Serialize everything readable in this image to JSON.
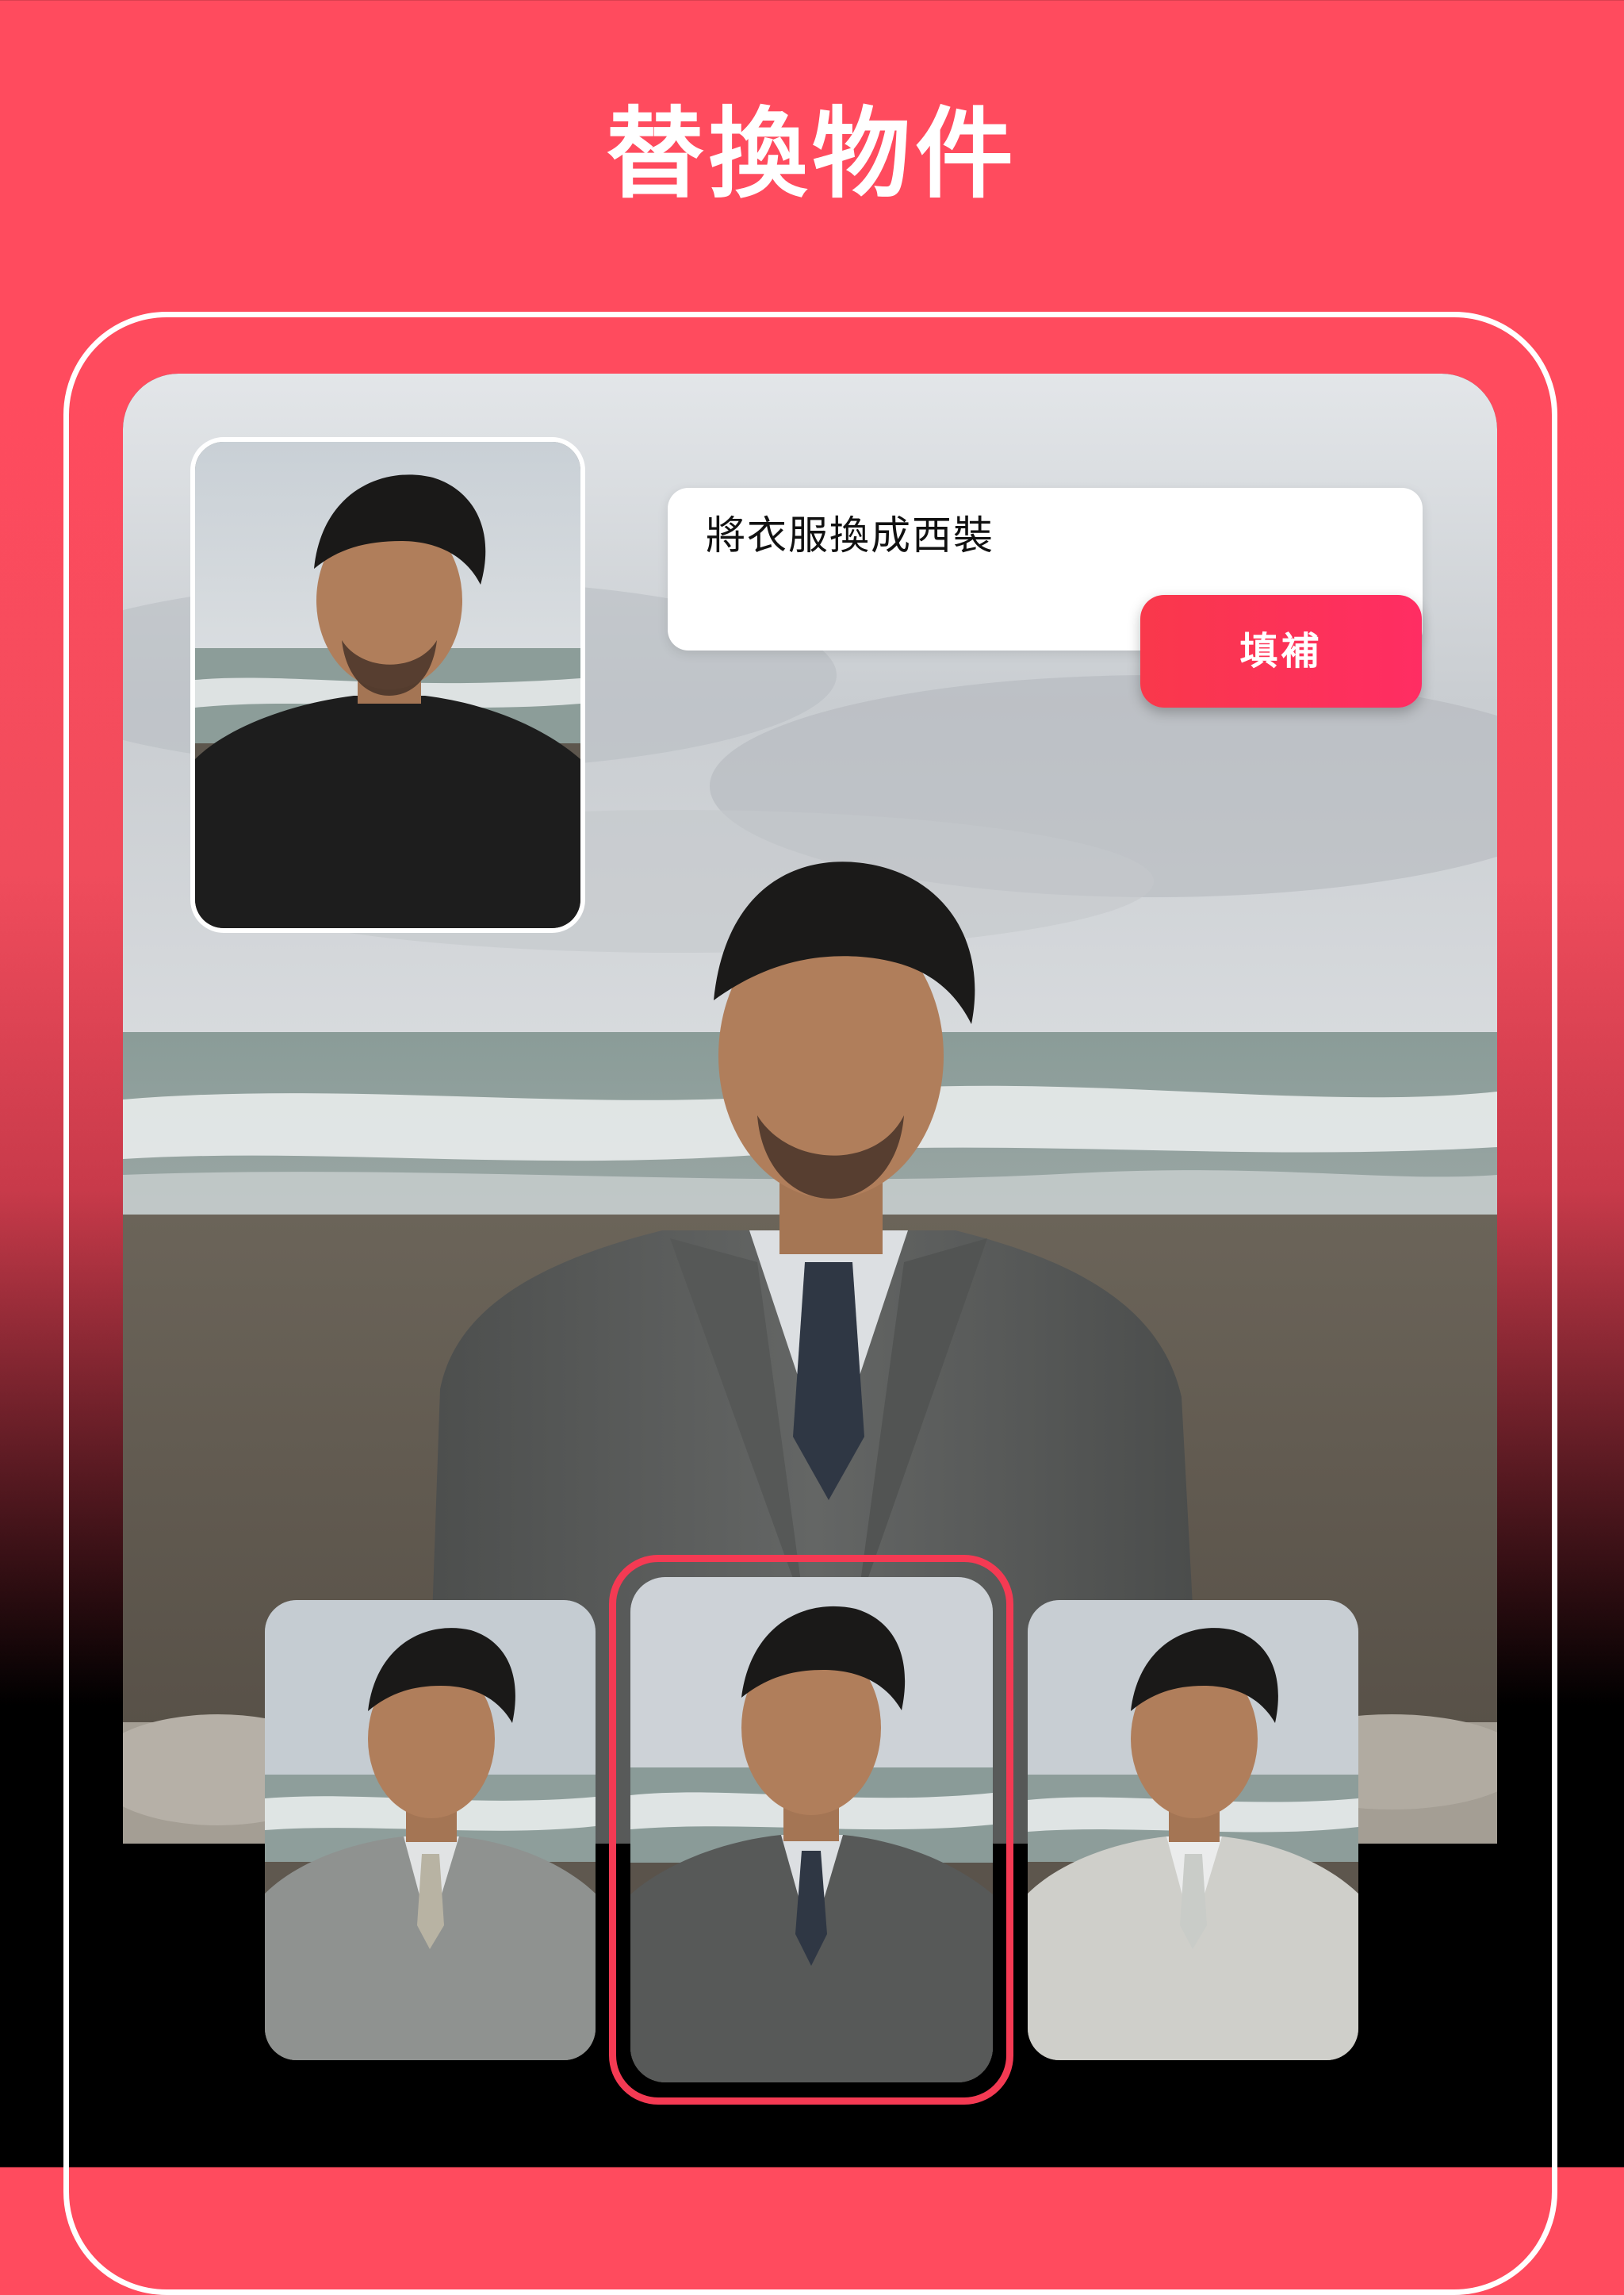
{
  "header": {
    "title": "替換物件"
  },
  "prompt": {
    "text": "將衣服換成西裝",
    "fill_button_label": "填補"
  },
  "results": {
    "count": 3,
    "selected_index": 1
  },
  "colors": {
    "brand_red": "#ff4b5e",
    "button_gradient_start": "#f9384b",
    "button_gradient_end": "#ff2d63",
    "selection_ring": "#f43a53"
  }
}
